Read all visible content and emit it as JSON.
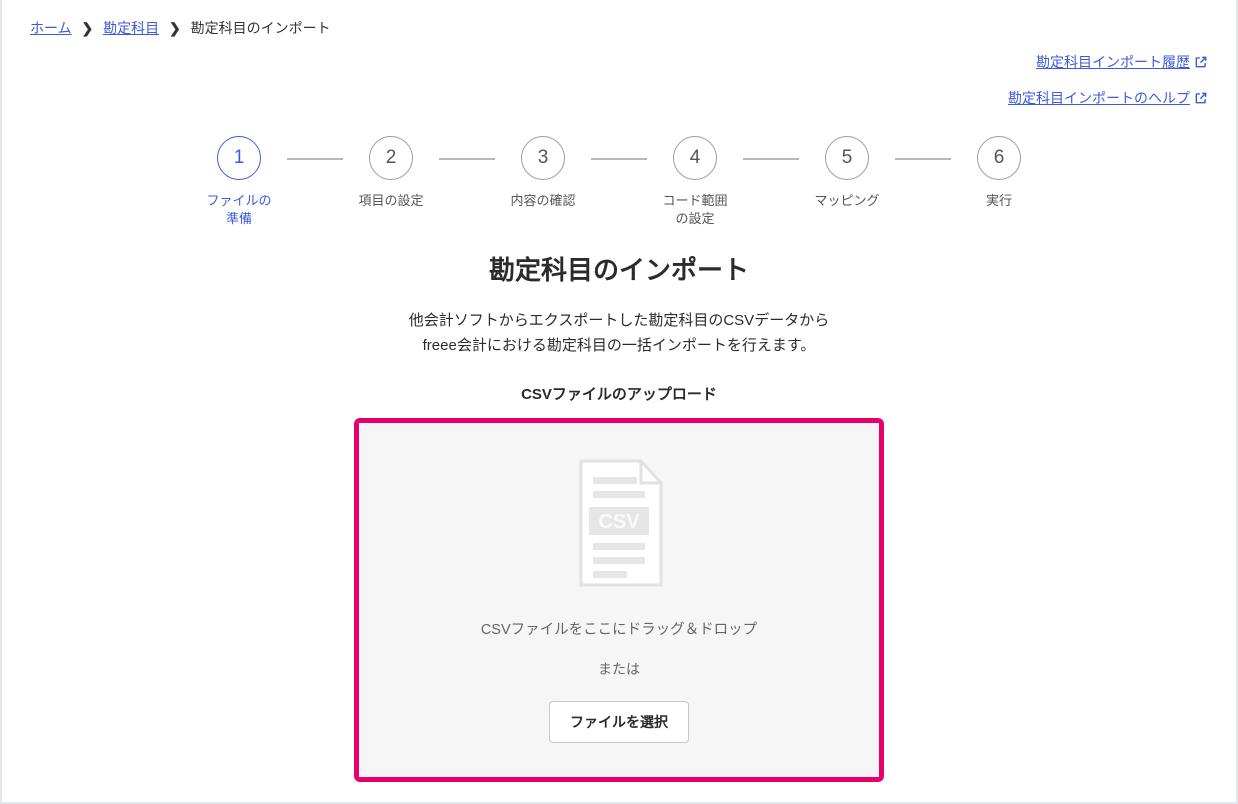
{
  "breadcrumb": {
    "home": "ホーム",
    "account": "勘定科目",
    "current": "勘定科目のインポート"
  },
  "links": {
    "history": "勘定科目インポート履歴",
    "help": "勘定科目インポートのヘルプ"
  },
  "steps": [
    {
      "num": "1",
      "label": "ファイルの\n準備",
      "active": true
    },
    {
      "num": "2",
      "label": "項目の設定",
      "active": false
    },
    {
      "num": "3",
      "label": "内容の確認",
      "active": false
    },
    {
      "num": "4",
      "label": "コード範囲\nの設定",
      "active": false
    },
    {
      "num": "5",
      "label": "マッピング",
      "active": false
    },
    {
      "num": "6",
      "label": "実行",
      "active": false
    }
  ],
  "title": "勘定科目のインポート",
  "desc_line1": "他会計ソフトからエクスポートした勘定科目のCSVデータから",
  "desc_line2": "freee会計における勘定科目の一括インポートを行えます。",
  "upload_heading": "CSVファイルのアップロード",
  "dropzone": {
    "text": "CSVファイルをここにドラッグ＆ドロップ",
    "or": "または",
    "button": "ファイルを選択",
    "icon_label": "CSV"
  }
}
